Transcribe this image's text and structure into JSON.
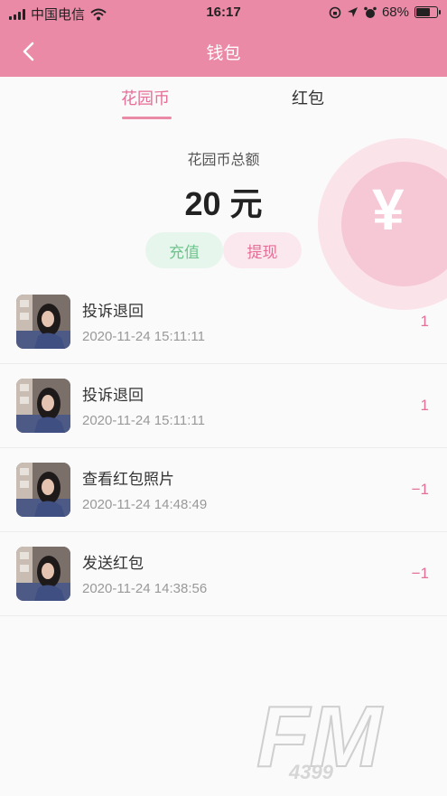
{
  "status_bar": {
    "carrier": "中国电信",
    "time": "16:17",
    "battery": "68%",
    "battery_level": 0.68
  },
  "nav": {
    "title": "钱包"
  },
  "tabs": {
    "coin": "花园币",
    "red_packet": "红包"
  },
  "summary": {
    "label": "花园币总额",
    "amount": "20 元"
  },
  "actions": {
    "charge": "充值",
    "withdraw": "提现"
  },
  "transactions": [
    {
      "title": "投诉退回",
      "time": "2020-11-24 15:11:11",
      "amount": "1"
    },
    {
      "title": "投诉退回",
      "time": "2020-11-24 15:11:11",
      "amount": "1"
    },
    {
      "title": "查看红包照片",
      "time": "2020-11-24 14:48:49",
      "amount": "−1"
    },
    {
      "title": "发送红包",
      "time": "2020-11-24 14:38:56",
      "amount": "−1"
    }
  ],
  "watermark": {
    "logo": "FM",
    "sub": "4399"
  },
  "colors": {
    "brand_pink": "#ea8aa6",
    "accent_pink": "#e56f95",
    "charge_green": "#6fc48e"
  },
  "icons": [
    "back-icon",
    "signal-icon",
    "wifi-icon",
    "location-icon",
    "alarm-icon",
    "lock-rotation-icon",
    "battery-icon",
    "yen-icon"
  ]
}
